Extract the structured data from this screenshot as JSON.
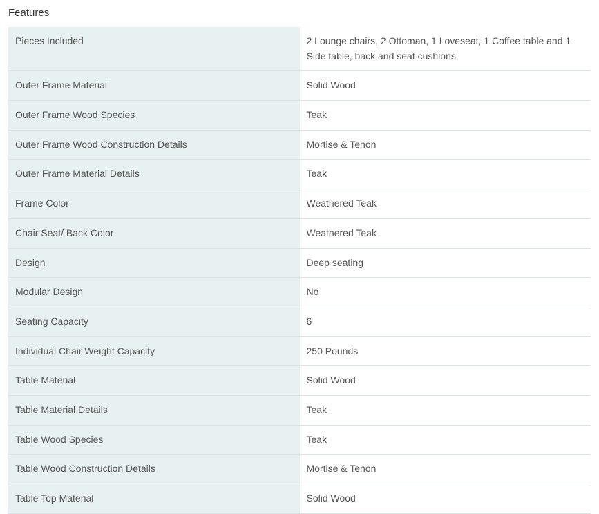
{
  "section": {
    "title": "Features"
  },
  "rows": [
    {
      "label": "Pieces Included",
      "value": "2 Lounge chairs, 2 Ottoman, 1 Loveseat, 1 Coffee table and 1 Side table, back and seat cushions",
      "indent": 0
    },
    {
      "label": "Outer Frame Material",
      "value": "Solid Wood",
      "indent": 0
    },
    {
      "label": "Outer Frame Wood Species",
      "value": "Teak",
      "indent": 1
    },
    {
      "label": "Outer Frame Wood Construction Details",
      "value": "Mortise & Tenon",
      "indent": 1
    },
    {
      "label": "Outer Frame Material Details",
      "value": "Teak",
      "indent": 1
    },
    {
      "label": "Frame Color",
      "value": "Weathered Teak",
      "indent": 0
    },
    {
      "label": "Chair Seat/ Back Color",
      "value": "Weathered Teak",
      "indent": 0
    },
    {
      "label": "Design",
      "value": "Deep seating",
      "indent": 0
    },
    {
      "label": "Modular Design",
      "value": "No",
      "indent": 0
    },
    {
      "label": "Seating Capacity",
      "value": "6",
      "indent": 0
    },
    {
      "label": "Individual Chair Weight Capacity",
      "value": "250 Pounds",
      "indent": 0
    },
    {
      "label": "Table Material",
      "value": "Solid Wood",
      "indent": 0
    },
    {
      "label": "Table Material Details",
      "value": "Teak",
      "indent": 1
    },
    {
      "label": "Table Wood Species",
      "value": "Teak",
      "indent": 1
    },
    {
      "label": "Table Wood Construction Details",
      "value": "Mortise & Tenon",
      "indent": 1
    },
    {
      "label": "Table Top Material",
      "value": "Solid Wood",
      "indent": 0
    }
  ]
}
